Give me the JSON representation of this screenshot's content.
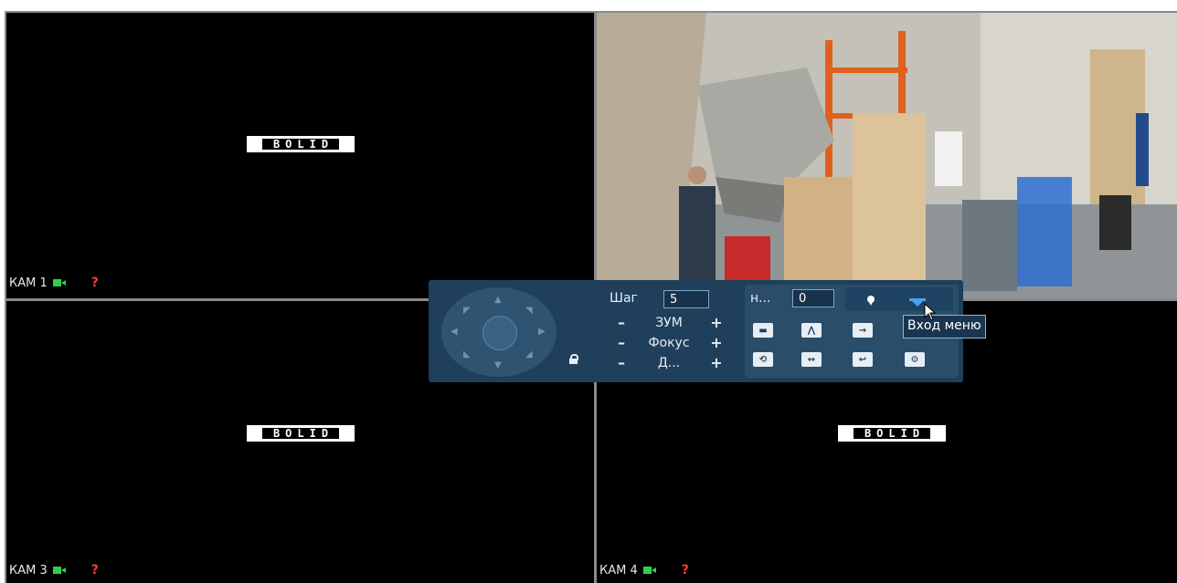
{
  "cameras": [
    {
      "label": "КАМ 1",
      "logo": "BOLID",
      "warning": "?"
    },
    {
      "label": "",
      "logo": "",
      "warning": ""
    },
    {
      "label": "КАМ 3",
      "logo": "BOLID",
      "warning": "?"
    },
    {
      "label": "КАМ 4",
      "logo": "BOLID",
      "warning": "?"
    }
  ],
  "tile_number": "3",
  "ptz": {
    "step_label": "Шаг",
    "step_value": "5",
    "zoom_label": "ЗУМ",
    "focus_label": "Фокус",
    "iris_label": "Д...",
    "minus": "–",
    "plus": "+",
    "preset_label": "н...",
    "preset_value": "0",
    "tooltip": "Вход меню",
    "icons": [
      "pin-icon",
      "menu-icon",
      "camera-icon",
      "tour-icon",
      "pattern-icon",
      "return-icon",
      "scan-icon",
      "flip-icon",
      "back-icon",
      "settings-icon"
    ]
  },
  "colors": {
    "panel": "#1f3f5a",
    "status_green": "#2ed04b",
    "warning_red": "#ff3b2f",
    "accent_blue": "#4aa3f0"
  }
}
